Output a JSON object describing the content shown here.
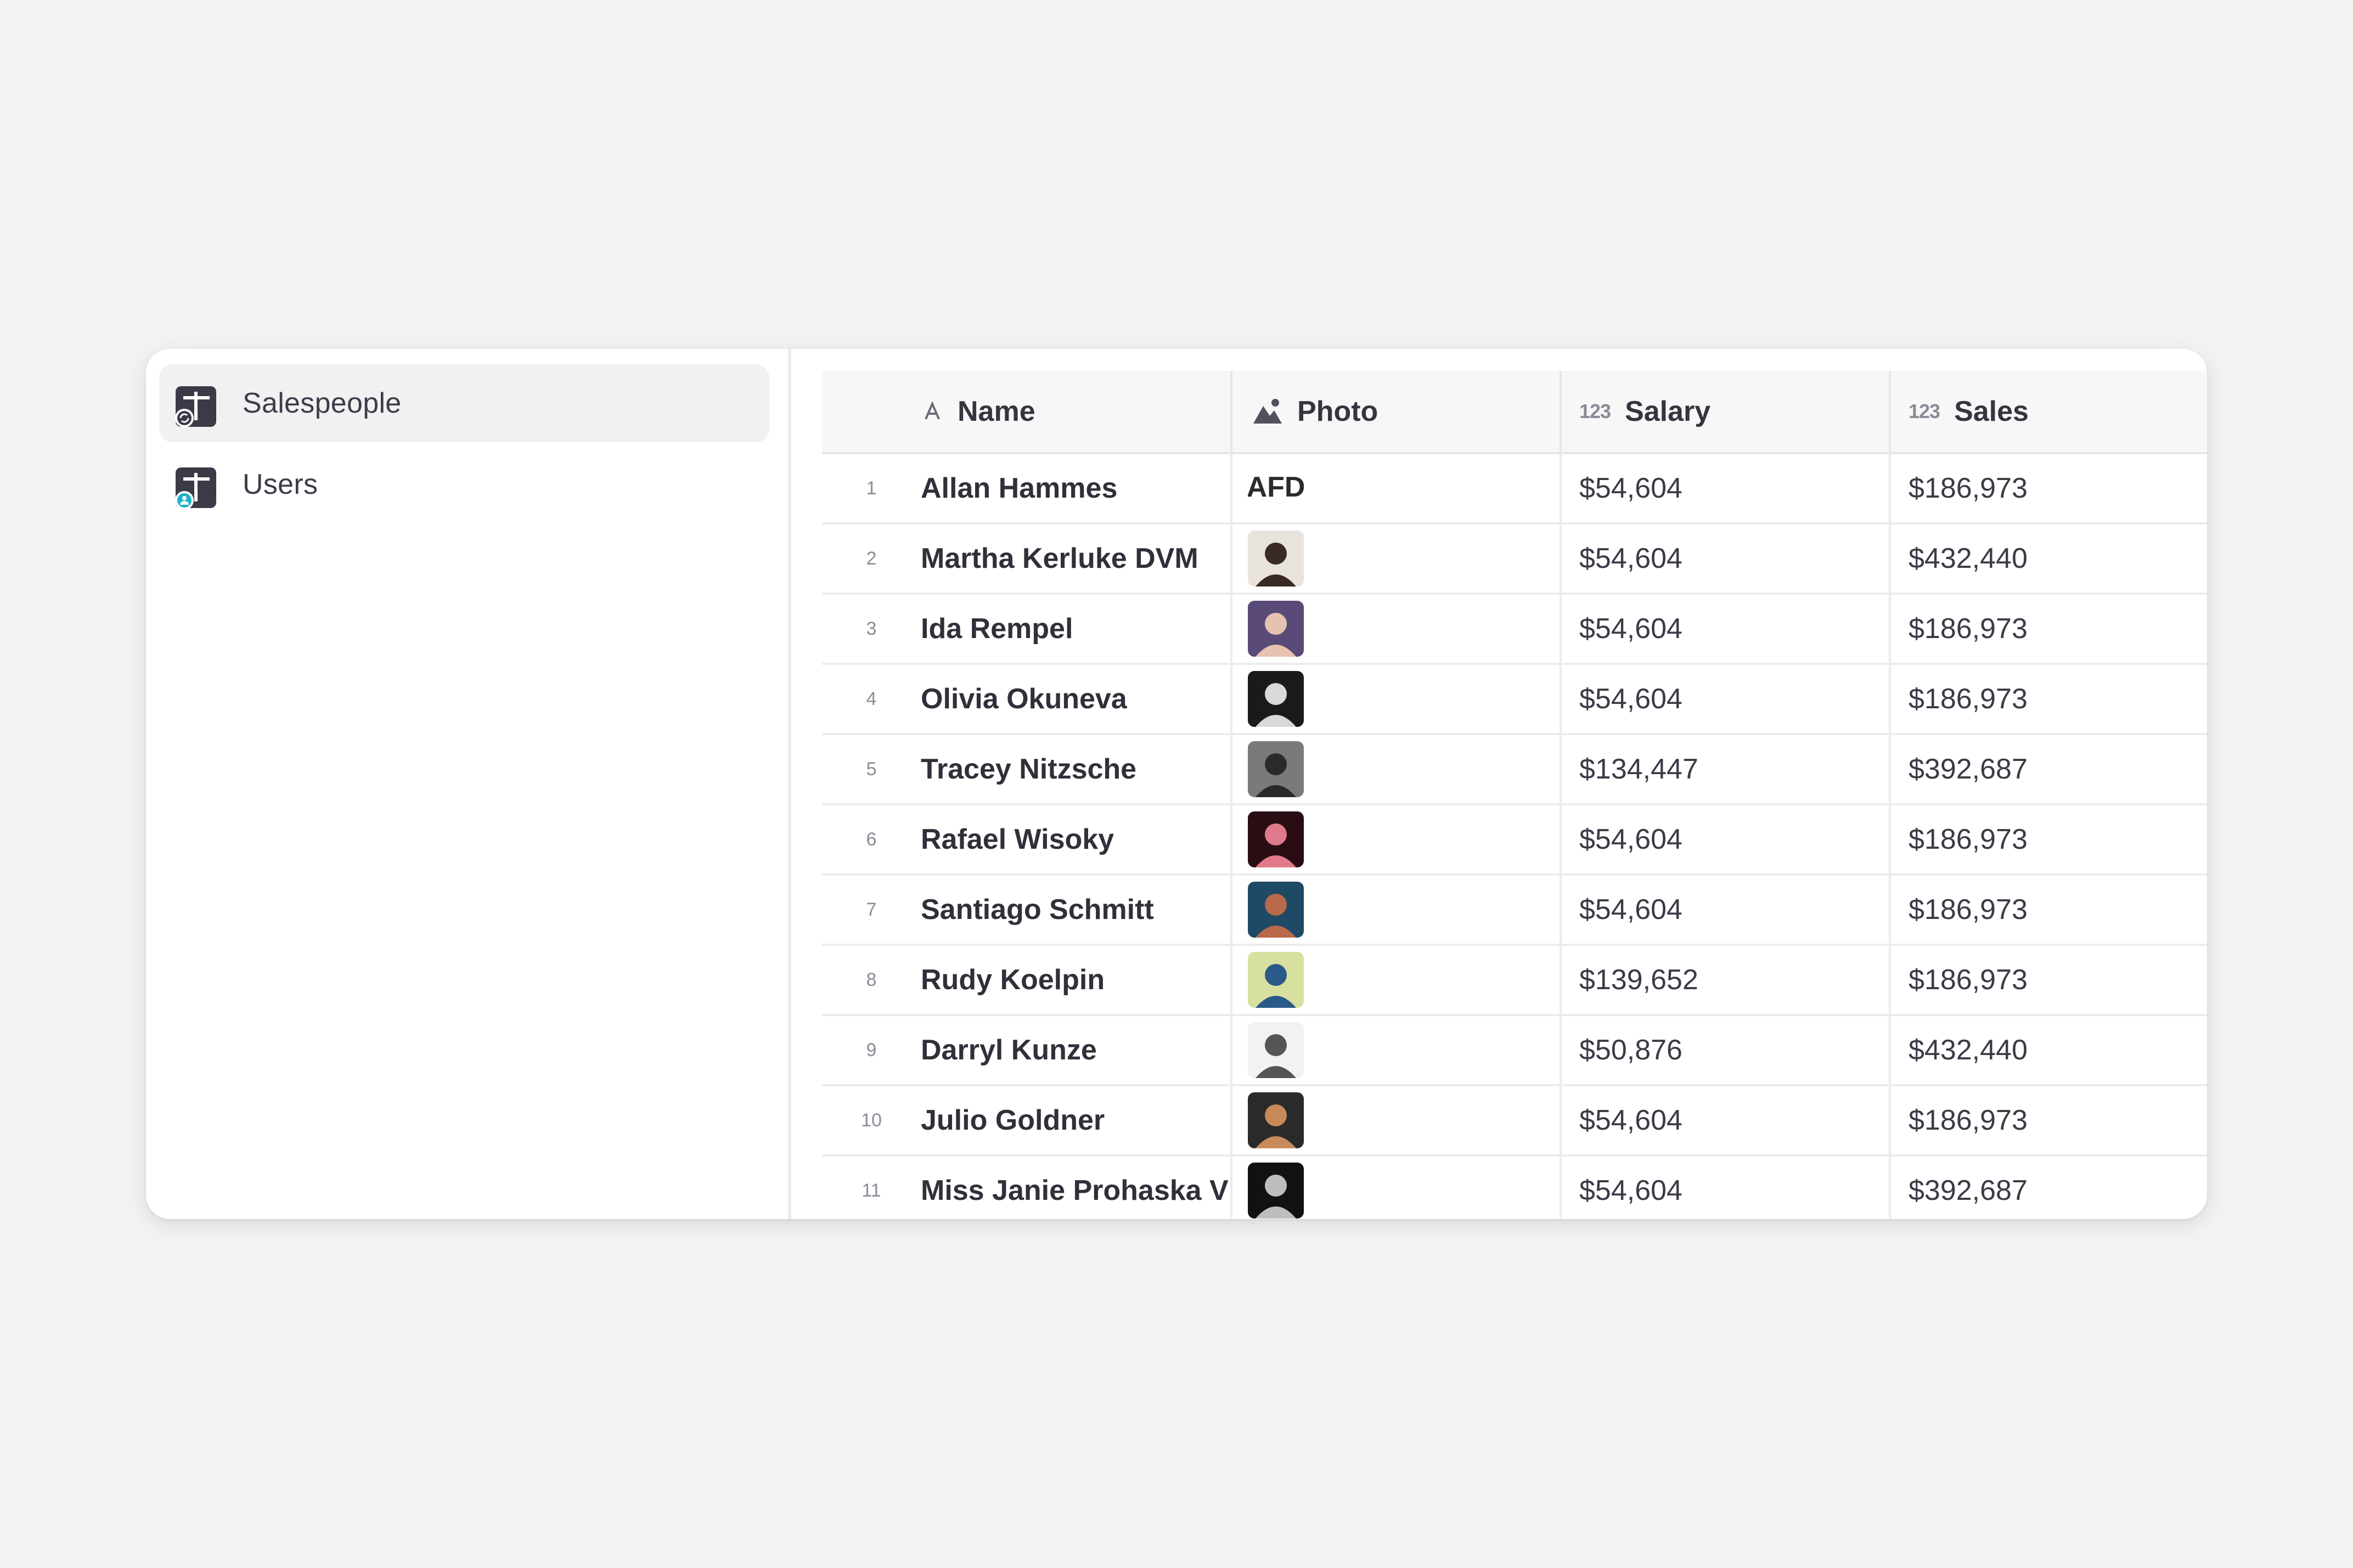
{
  "sidebar": {
    "items": [
      {
        "label": "Salespeople",
        "active": true,
        "icon": "table-sync-icon"
      },
      {
        "label": "Users",
        "active": false,
        "icon": "table-user-icon"
      }
    ]
  },
  "table": {
    "columns": [
      {
        "label": "Name",
        "icon": "text-type-icon"
      },
      {
        "label": "Photo",
        "icon": "image-type-icon"
      },
      {
        "label": "Salary",
        "icon": "number-type-icon",
        "icon_text": "123"
      },
      {
        "label": "Sales",
        "icon": "number-type-icon",
        "icon_text": "123"
      }
    ],
    "rows": [
      {
        "n": "1",
        "name": "Allan Hammes",
        "salary": "$54,604",
        "sales": "$186,973",
        "photo_text": "AFD"
      },
      {
        "n": "2",
        "name": "Martha Kerluke DVM",
        "salary": "$54,604",
        "sales": "$432,440"
      },
      {
        "n": "3",
        "name": "Ida Rempel",
        "salary": "$54,604",
        "sales": "$186,973"
      },
      {
        "n": "4",
        "name": "Olivia Okuneva",
        "salary": "$54,604",
        "sales": "$186,973"
      },
      {
        "n": "5",
        "name": "Tracey Nitzsche",
        "salary": "$134,447",
        "sales": "$392,687"
      },
      {
        "n": "6",
        "name": "Rafael Wisoky",
        "salary": "$54,604",
        "sales": "$186,973"
      },
      {
        "n": "7",
        "name": "Santiago Schmitt",
        "salary": "$54,604",
        "sales": "$186,973"
      },
      {
        "n": "8",
        "name": "Rudy Koelpin",
        "salary": "$139,652",
        "sales": "$186,973"
      },
      {
        "n": "9",
        "name": "Darryl Kunze",
        "salary": "$50,876",
        "sales": "$432,440"
      },
      {
        "n": "10",
        "name": "Julio Goldner",
        "salary": "$54,604",
        "sales": "$186,973"
      },
      {
        "n": "11",
        "name": "Miss Janie Prohaska V",
        "salary": "$54,604",
        "sales": "$392,687"
      }
    ]
  }
}
